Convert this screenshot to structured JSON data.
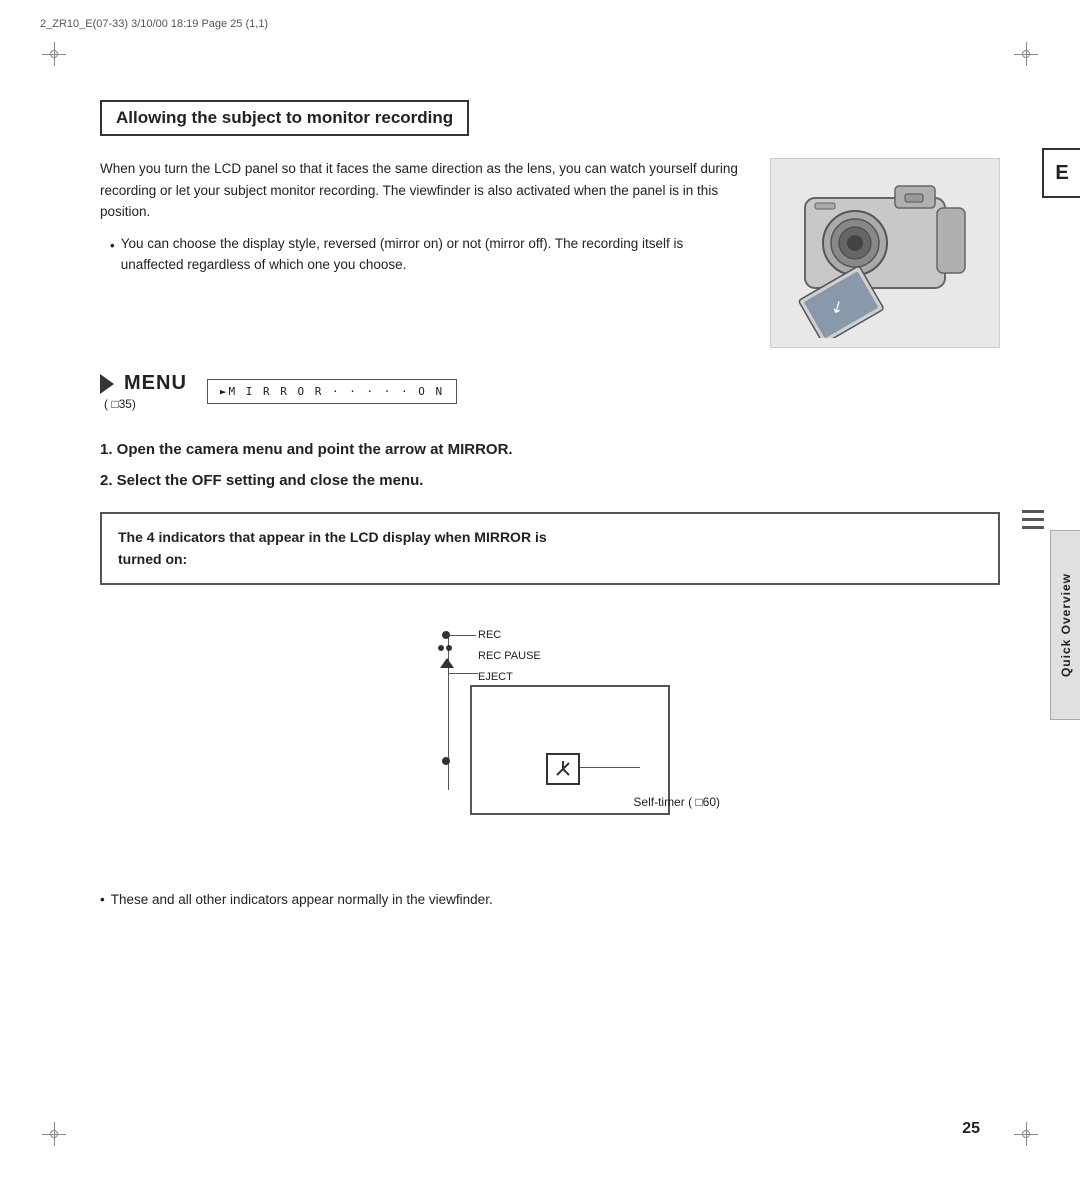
{
  "header": {
    "left": "2_ZR10_E(07-33)  3/10/00 18:19  Page 25 (1,1)"
  },
  "section": {
    "title": "Allowing the subject to monitor recording",
    "body_text": "When you turn the LCD panel so that it faces the same direction as the lens, you can watch yourself during recording or let your subject monitor recording. The viewfinder is also activated when the panel is in this position.",
    "bullet_text": "You can choose the display style, reversed (mirror on) or not (mirror off). The recording itself is unaffected regardless of which one you choose.",
    "menu_ref": "( □35)",
    "menu_display": "►M I R R O R · · · · · O N",
    "step1": "1.  Open the camera menu and point the arrow at MIRROR.",
    "step2": "2.  Select the OFF setting and close the menu.",
    "info_box_line1": "The 4 indicators that appear in the LCD display when MIRROR is",
    "info_box_line2": " turned on:",
    "indicators": {
      "rec": "REC",
      "rec_pause": "REC PAUSE",
      "eject": "EJECT",
      "self_timer": "Self-timer ( □60)"
    },
    "bottom_bullet": "These and all other indicators appear normally in the viewfinder."
  },
  "sidebar": {
    "tab_e": "E",
    "quick_overview": "Quick Overview"
  },
  "page_number": "25",
  "icons": {
    "bullet": "•",
    "menu_arrow": "►"
  }
}
